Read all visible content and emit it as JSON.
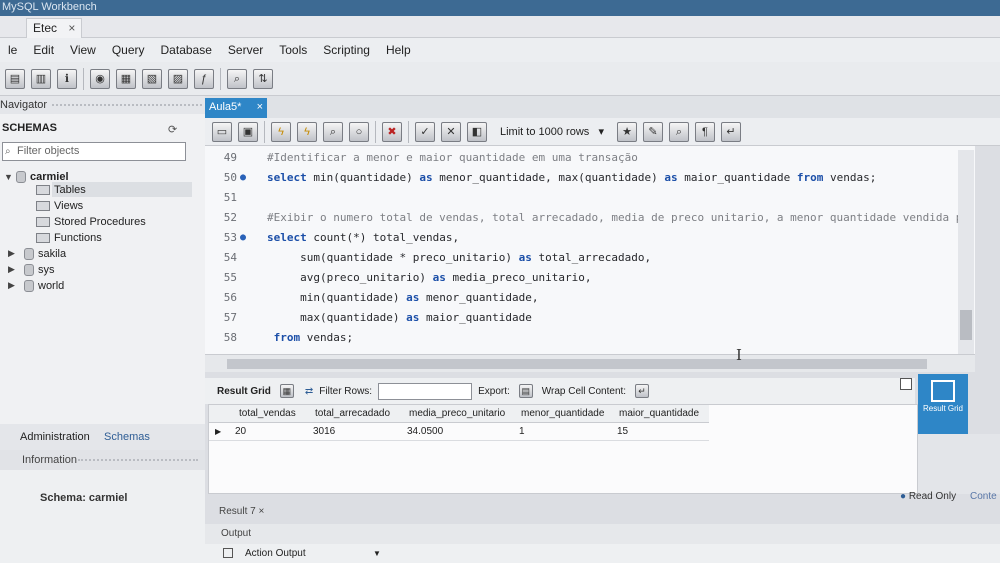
{
  "window": {
    "title": "MySQL Workbench",
    "connection_tab": "Etec",
    "close_glyph": "×"
  },
  "menu": [
    "le",
    "Edit",
    "View",
    "Query",
    "Database",
    "Server",
    "Tools",
    "Scripting",
    "Help"
  ],
  "navigator": {
    "header": "Navigator",
    "schemas_title": "SCHEMAS",
    "filter_placeholder": "Filter objects",
    "tree": [
      {
        "label": "carmiel",
        "expanded": true
      },
      {
        "label": "Tables",
        "child": true,
        "selected": true
      },
      {
        "label": "Views",
        "child": true
      },
      {
        "label": "Stored Procedures",
        "child": true
      },
      {
        "label": "Functions",
        "child": true
      },
      {
        "label": "sakila"
      },
      {
        "label": "sys"
      },
      {
        "label": "world"
      }
    ],
    "bottom_tabs": {
      "administration": "Administration",
      "schemas": "Schemas"
    },
    "information_header": "Information",
    "schema_info": "Schema: carmiel"
  },
  "editor": {
    "tab_label": "Aula5*",
    "limit_label": "Limit to 1000 rows",
    "lines": [
      {
        "n": "49",
        "text": "#Identificar a menor e maior quantidade em uma transação",
        "type": "comment"
      },
      {
        "n": "50",
        "text": "select min(quantidade) as menor_quantidade, max(quantidade) as maior_quantidade from vendas;",
        "type": "code",
        "marker": true
      },
      {
        "n": "51",
        "text": "",
        "type": "code"
      },
      {
        "n": "52",
        "text": "#Exibir o numero total de vendas, total arrecadado, media de preco unitario, a menor quantidade vendida po",
        "type": "comment"
      },
      {
        "n": "53",
        "text": "select count(*) total_vendas,",
        "type": "code",
        "marker": true
      },
      {
        "n": "54",
        "text": "     sum(quantidade * preco_unitario) as total_arrecadado,",
        "type": "code"
      },
      {
        "n": "55",
        "text": "     avg(preco_unitario) as media_preco_unitario,",
        "type": "code"
      },
      {
        "n": "56",
        "text": "     min(quantidade) as menor_quantidade,",
        "type": "code"
      },
      {
        "n": "57",
        "text": "     max(quantidade) as maior_quantidade",
        "type": "code"
      },
      {
        "n": "58",
        "text": " from vendas;",
        "type": "code"
      }
    ]
  },
  "results": {
    "result_grid_label": "Result Grid",
    "filter_rows_label": "Filter Rows:",
    "export_label": "Export:",
    "wrap_label": "Wrap Cell Content:",
    "columns": [
      "total_vendas",
      "total_arrecadado",
      "media_preco_unitario",
      "menor_quantidade",
      "maior_quantidade"
    ],
    "rows": [
      [
        "20",
        "3016",
        "34.0500",
        "1",
        "15"
      ]
    ],
    "side_button": "Result Grid",
    "read_only": "Read Only",
    "context": "Conte",
    "result_tab": "Result 7",
    "output_header": "Output",
    "output_select": "Action Output"
  }
}
